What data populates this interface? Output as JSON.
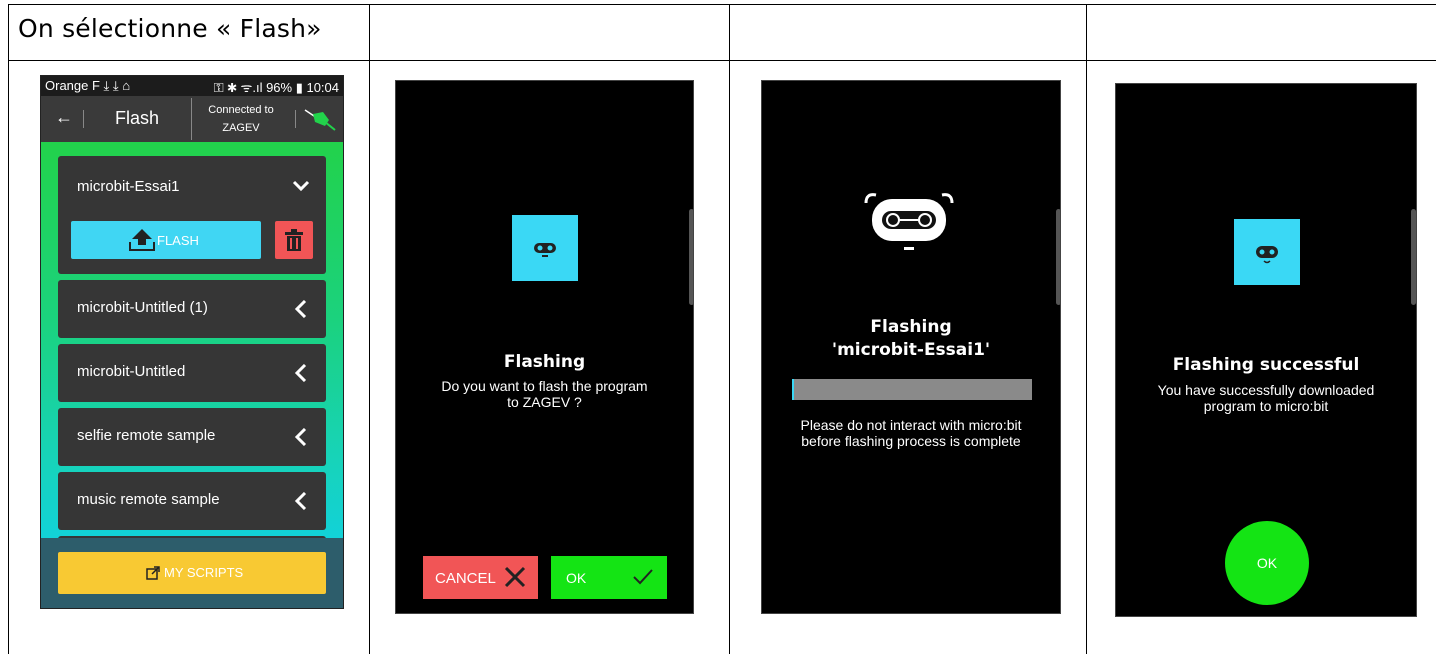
{
  "caption": "On sélectionne « Flash»",
  "screen1": {
    "status_left": "Orange F ⤓ ⤓ ⌂",
    "status_right": "⚿ ✱ ᯤ.ıl 96% ▮ 10:04",
    "back_icon": "arrow-left-icon",
    "title": "Flash",
    "connected_line1": "Connected to",
    "connected_line2": "ZAGEV",
    "plug_icon": "plug-icon",
    "plug_color": "#22d24b",
    "scripts": [
      {
        "name": "microbit-Essai1",
        "expanded": true
      },
      {
        "name": "microbit-Untitled (1)",
        "expanded": false
      },
      {
        "name": "microbit-Untitled",
        "expanded": false
      },
      {
        "name": "selfie remote sample",
        "expanded": false
      },
      {
        "name": "music remote sample",
        "expanded": false
      }
    ],
    "flash_button": "FLASH",
    "my_scripts_button": "MY SCRIPTS",
    "colors": {
      "flash": "#40d6f3",
      "delete": "#f15556",
      "my_scripts": "#f8c933"
    }
  },
  "screen2": {
    "title": "Flashing",
    "message_line1": "Do you want to flash the program",
    "message_line2": "to ZAGEV ?",
    "cancel_label": "CANCEL",
    "ok_label": "OK"
  },
  "screen3": {
    "title_line1": "Flashing",
    "title_line2": "'microbit-Essai1'",
    "progress": 0.01,
    "note_line1": "Please do not interact with micro:bit",
    "note_line2": "before flashing process is complete"
  },
  "screen4": {
    "title": "Flashing successful",
    "message_line1": "You have successfully downloaded",
    "message_line2": "program to micro:bit",
    "ok_label": "OK"
  }
}
